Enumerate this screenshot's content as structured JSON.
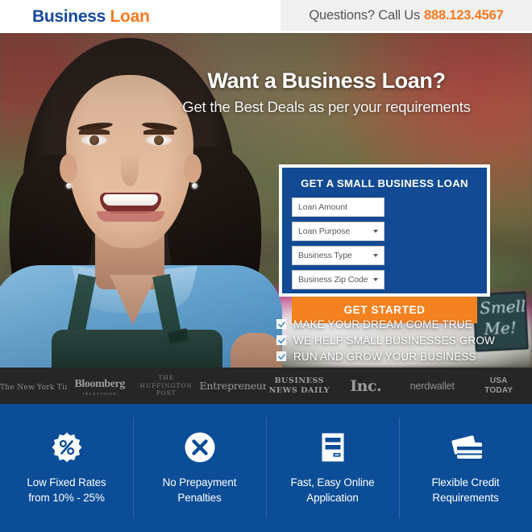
{
  "header": {
    "logo_primary": "Business",
    "logo_secondary": "Loan",
    "questions_text": "Questions? Call Us",
    "phone": "888.123.4567"
  },
  "hero": {
    "title": "Want a Business Loan?",
    "subtitle": "Get the Best Deals as per your requirements",
    "background_sign_line1": "Smell",
    "background_sign_line2": "Me!"
  },
  "form": {
    "title": "GET A SMALL BUSINESS LOAN",
    "fields": [
      {
        "name": "loan-amount",
        "placeholder": "Loan Amount",
        "type": "text"
      },
      {
        "name": "loan-purpose",
        "placeholder": "Loan Purpose",
        "type": "select"
      },
      {
        "name": "business-type",
        "placeholder": "Business Type",
        "type": "select"
      },
      {
        "name": "business-zip-code",
        "placeholder": "Business Zip Code",
        "type": "select"
      }
    ],
    "submit_label": "GET STARTED"
  },
  "benefits": [
    {
      "text": "MAKE YOUR DREAM COME TRUE"
    },
    {
      "text": "WE HELP SMALL BUSINESSES GROW"
    },
    {
      "text": "RUN AND GROW YOUR BUSINESS"
    }
  ],
  "press_logos": [
    {
      "name": "the-new-york-times",
      "text": "The New York Times"
    },
    {
      "name": "bloomberg",
      "text": "Bloomberg",
      "sub": "TELEVISION"
    },
    {
      "name": "the-huffington-post",
      "line1": "THE",
      "line2": "HUFFINGTON",
      "line3": "POST"
    },
    {
      "name": "entrepreneur",
      "text": "Entrepreneur"
    },
    {
      "name": "business-news-daily",
      "line1": "BUSINESS",
      "line2": "NEWS DAILY"
    },
    {
      "name": "inc",
      "text": "Inc."
    },
    {
      "name": "nerdwallet",
      "text": "nerdwallet"
    },
    {
      "name": "usa-today",
      "line1": "USA",
      "line2": "TODAY"
    }
  ],
  "features": [
    {
      "icon": "percent-badge-icon",
      "line1": "Low Fixed Rates",
      "line2": "from 10% - 25%"
    },
    {
      "icon": "circle-x-icon",
      "line1": "No Prepayment",
      "line2": "Penalties"
    },
    {
      "icon": "online-form-icon",
      "line1": "Fast, Easy Online",
      "line2": "Application"
    },
    {
      "icon": "credit-cards-icon",
      "line1": "Flexible Credit",
      "line2": "Requirements"
    }
  ],
  "colors": {
    "brand_blue": "#14499c",
    "brand_orange": "#f47a20",
    "form_blue": "#124a94",
    "cta_orange": "#f58220",
    "features_blue": "#0b4d96",
    "press_dark": "#262626"
  }
}
